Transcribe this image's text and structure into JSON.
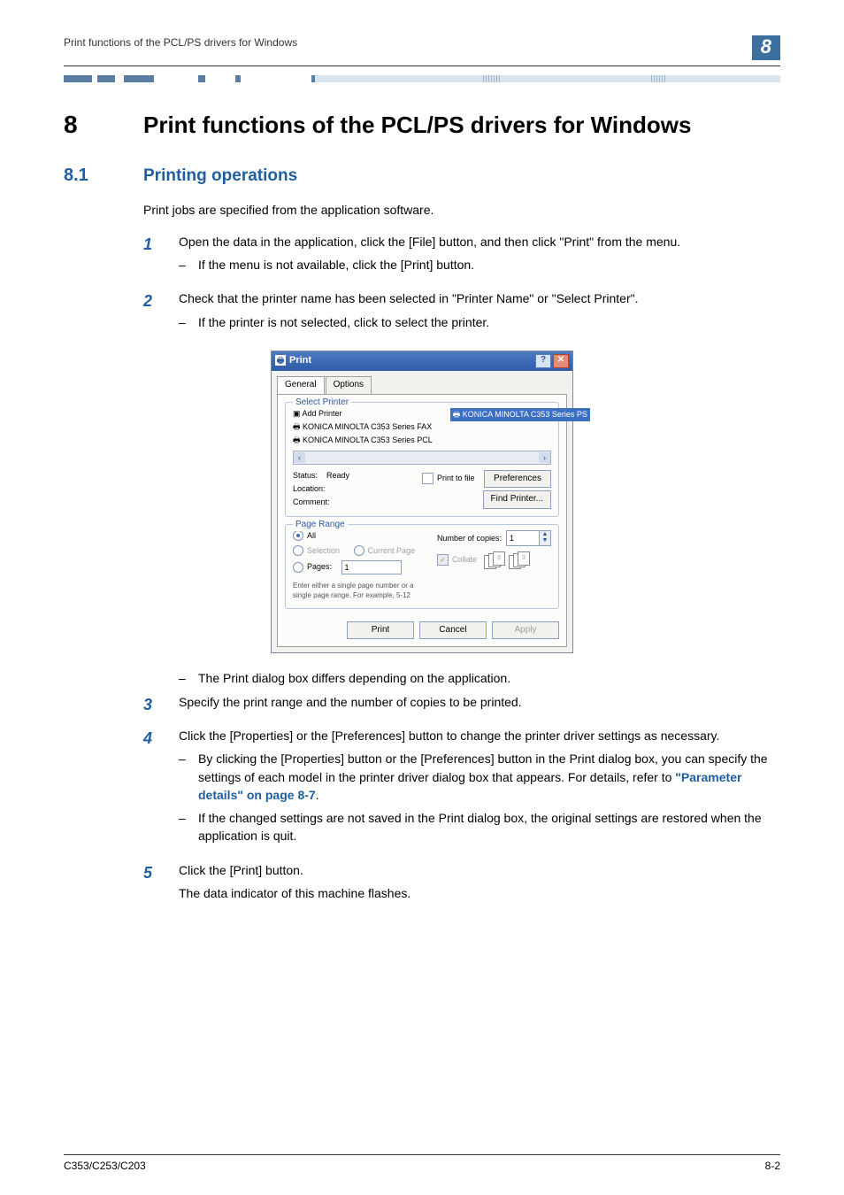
{
  "header": {
    "breadcrumb": "Print functions of the PCL/PS drivers for Windows",
    "chapter_badge": "8"
  },
  "chapter": {
    "number": "8",
    "title": "Print functions of the PCL/PS drivers for Windows"
  },
  "section": {
    "number": "8.1",
    "title": "Printing operations",
    "intro": "Print jobs are specified from the application software."
  },
  "steps": {
    "s1": {
      "num": "1",
      "text": "Open the data in the application, click the [File] button, and then click \"Print\" from the menu.",
      "sub1": "If the menu is not available, click the [Print] button."
    },
    "s2": {
      "num": "2",
      "text": "Check that the printer name has been selected in \"Printer Name\" or \"Select Printer\".",
      "sub1": "If the printer is not selected, click to select the printer.",
      "sub2": "The Print dialog box differs depending on the application."
    },
    "s3": {
      "num": "3",
      "text": "Specify the print range and the number of copies to be printed."
    },
    "s4": {
      "num": "4",
      "text": "Click the [Properties] or the [Preferences] button to change the printer driver settings as necessary.",
      "sub1a": "By clicking the [Properties] button or the [Preferences] button in the Print dialog box, you can specify the settings of each model in the printer driver dialog box that appears. For details, refer to ",
      "sub1link": "\"Parameter details\" on page 8-7",
      "sub1b": ".",
      "sub2": "If the changed settings are not saved in the Print dialog box, the original settings are restored when the application is quit."
    },
    "s5": {
      "num": "5",
      "text": "Click the [Print] button.",
      "after": "The data indicator of this machine flashes."
    }
  },
  "dialog": {
    "title": "Print",
    "tabs": {
      "general": "General",
      "options": "Options"
    },
    "select_printer": {
      "legend": "Select Printer",
      "add_printer": "Add Printer",
      "fax": "KONICA MINOLTA C353 Series FAX",
      "pcl": "KONICA MINOLTA C353 Series PCL",
      "ps": "KONICA MINOLTA C353 Series PS"
    },
    "status": {
      "status_label": "Status:",
      "status_value": "Ready",
      "location_label": "Location:",
      "comment_label": "Comment:",
      "print_to_file": "Print to file",
      "preferences": "Preferences",
      "find_printer": "Find Printer..."
    },
    "page_range": {
      "legend": "Page Range",
      "all": "All",
      "selection": "Selection",
      "current_page": "Current Page",
      "pages_label": "Pages:",
      "pages_value": "1",
      "help": "Enter either a single page number or a single page range.  For example, 5-12",
      "copies_label": "Number of copies:",
      "copies_value": "1",
      "collate": "Collate"
    },
    "footer": {
      "print": "Print",
      "cancel": "Cancel",
      "apply": "Apply"
    }
  },
  "footer": {
    "left": "C353/C253/C203",
    "right": "8-2"
  },
  "dash": "–"
}
